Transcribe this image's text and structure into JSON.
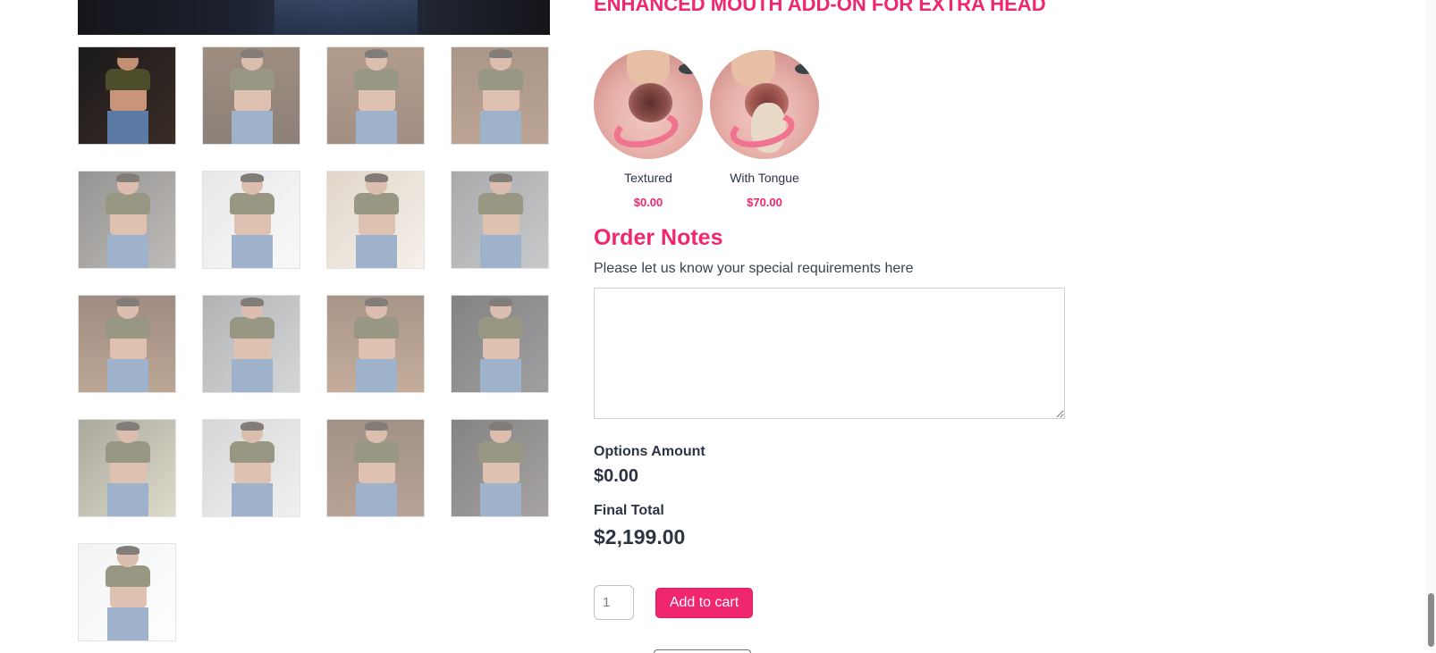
{
  "gallery": {
    "thumbnails": [
      {
        "name": "thumb-1",
        "active": true
      },
      {
        "name": "thumb-2",
        "active": false
      },
      {
        "name": "thumb-3",
        "active": false
      },
      {
        "name": "thumb-4",
        "active": false
      },
      {
        "name": "thumb-5",
        "active": false
      },
      {
        "name": "thumb-6",
        "active": false
      },
      {
        "name": "thumb-7",
        "active": false
      },
      {
        "name": "thumb-8",
        "active": false
      },
      {
        "name": "thumb-9",
        "active": false
      },
      {
        "name": "thumb-10",
        "active": false
      },
      {
        "name": "thumb-11",
        "active": false
      },
      {
        "name": "thumb-12",
        "active": false
      },
      {
        "name": "thumb-13",
        "active": false
      },
      {
        "name": "thumb-14",
        "active": false
      },
      {
        "name": "thumb-15",
        "active": false
      },
      {
        "name": "thumb-16",
        "active": false
      },
      {
        "name": "thumb-17",
        "active": false
      }
    ]
  },
  "addon": {
    "title": "ENHANCED MOUTH ADD-ON FOR EXTRA HEAD",
    "options": [
      {
        "label": "Textured",
        "price": "$0.00"
      },
      {
        "label": "With Tongue",
        "price": "$70.00"
      }
    ]
  },
  "order_notes": {
    "heading": "Order Notes",
    "hint": "Please let us know your special requirements here",
    "value": ""
  },
  "totals": {
    "options_label": "Options Amount",
    "options_value": "$0.00",
    "final_label": "Final Total",
    "final_value": "$2,199.00"
  },
  "cart": {
    "quantity": "1",
    "add_label": "Add to cart"
  },
  "colors": {
    "accent": "#f0266f",
    "text": "#2c3343"
  }
}
